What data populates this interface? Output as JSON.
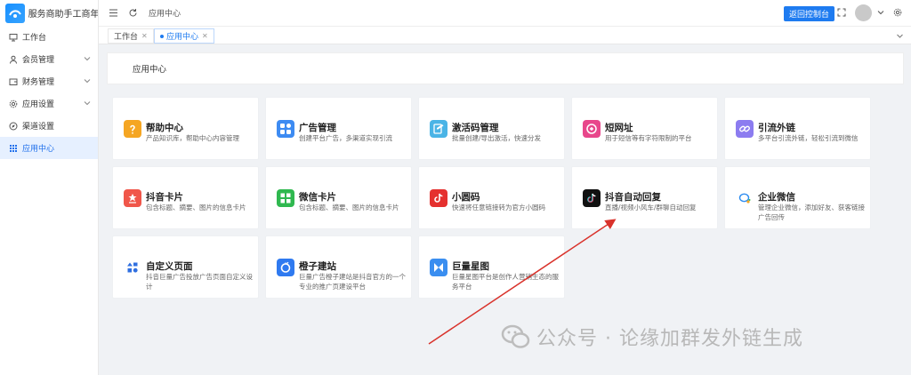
{
  "app": {
    "title": "服务商助手工商年报"
  },
  "sidebar": {
    "items": [
      {
        "label": "工作台",
        "icon": "monitor-icon",
        "expandable": false,
        "active": false
      },
      {
        "label": "会员管理",
        "icon": "user-icon",
        "expandable": true,
        "active": false
      },
      {
        "label": "财务管理",
        "icon": "wallet-icon",
        "expandable": true,
        "active": false
      },
      {
        "label": "应用设置",
        "icon": "gear-icon",
        "expandable": true,
        "active": false
      },
      {
        "label": "渠道设置",
        "icon": "compass-icon",
        "expandable": false,
        "active": false
      },
      {
        "label": "应用中心",
        "icon": "grid-icon",
        "expandable": false,
        "active": true
      }
    ]
  },
  "topbar": {
    "breadcrumb": "应用中心",
    "back_button": "返回控制台"
  },
  "tabs": [
    {
      "label": "工作台",
      "active": false
    },
    {
      "label": "应用中心",
      "active": true
    }
  ],
  "page": {
    "title": "应用中心"
  },
  "cards": [
    {
      "title": "帮助中心",
      "desc": "产品知识库，帮助中心内容管理",
      "icon": "help-icon",
      "color": "#f5a623"
    },
    {
      "title": "广告管理",
      "desc": "创建平台广告，多渠道实现引流",
      "icon": "apps-icon",
      "color": "#3d8bf2"
    },
    {
      "title": "激活码管理",
      "desc": "批量创建/导出激活，快速分发",
      "icon": "edit-icon",
      "color": "#4ab4e6"
    },
    {
      "title": "短网址",
      "desc": "用于短信等有字符限制的平台",
      "icon": "link-icon",
      "color": "#e8478b"
    },
    {
      "title": "引流外链",
      "desc": "多平台引流外链，轻松引流到微信",
      "icon": "chain-icon",
      "color": "#8c7cf0"
    },
    {
      "title": "抖音卡片",
      "desc": "包含标题、摘要、图片的信息卡片",
      "icon": "card-icon",
      "color": "#f0564a"
    },
    {
      "title": "微信卡片",
      "desc": "包含标题、摘要、图片的信息卡片",
      "icon": "wechat-card-icon",
      "color": "#2fb84f"
    },
    {
      "title": "小圆码",
      "desc": "快速将任意链接转为官方小圆码",
      "icon": "douyin-icon",
      "color": "#e5312f"
    },
    {
      "title": "抖音自动回复",
      "desc": "直播/视频小风车/群聊自动回复",
      "icon": "tiktok-icon",
      "color": "#111111"
    },
    {
      "title": "企业微信",
      "desc": "管理企业微信，添加好友、获客链接广告回传",
      "icon": "wecom-icon",
      "color": "#2d8cf0"
    },
    {
      "title": "自定义页面",
      "desc": "抖音巨量广告投放广告页面自定义设计",
      "icon": "shapes-icon",
      "color": "#2f6fe0"
    },
    {
      "title": "橙子建站",
      "desc": "巨量广告橙子建站是抖音官方的一个专业的推广页建设平台",
      "icon": "orange-site-icon",
      "color": "#2f7af0"
    },
    {
      "title": "巨量星图",
      "desc": "巨量星图平台是创作人营销生态的服务平台",
      "icon": "star-map-icon",
      "color": "#3a8ef0"
    }
  ],
  "watermark": {
    "text": "公众号 · 论缘加群发外链生成"
  }
}
